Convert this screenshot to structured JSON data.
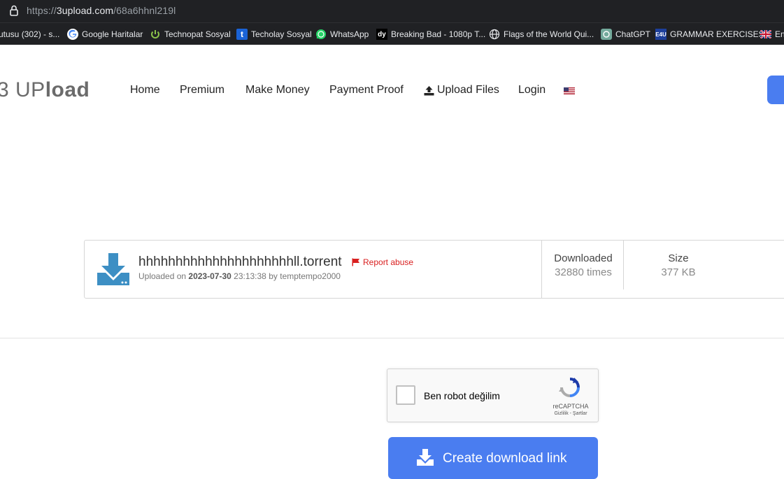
{
  "browser": {
    "url_prefix": "https://",
    "url_host": "3upload.com",
    "url_path": "/68a6hhnl219l",
    "bookmarks": [
      {
        "label": "utusu (302) - s...",
        "icon": "partial-icon"
      },
      {
        "label": "Google Haritalar",
        "icon": "google-icon"
      },
      {
        "label": "Technopat Sosyal",
        "icon": "power-icon"
      },
      {
        "label": "Techolay Sosyal",
        "icon": "techolay-icon"
      },
      {
        "label": "WhatsApp",
        "icon": "whatsapp-icon"
      },
      {
        "label": "Breaking Bad - 1080p T...",
        "icon": "dy-icon"
      },
      {
        "label": "Flags of the World Qui...",
        "icon": "globe-icon"
      },
      {
        "label": "ChatGPT",
        "icon": "chatgpt-icon"
      },
      {
        "label": "GRAMMAR EXERCISES",
        "icon": "esl-icon"
      },
      {
        "label": "En",
        "icon": "uk-flag-icon"
      }
    ]
  },
  "site": {
    "logo_a": "3 UP",
    "logo_b": "load",
    "nav": {
      "home": "Home",
      "premium": "Premium",
      "make_money": "Make Money",
      "payment_proof": "Payment Proof",
      "upload_files": "Upload Files",
      "login": "Login"
    },
    "accent": "#4a7df0"
  },
  "file": {
    "name": "hhhhhhhhhhhhhhhhhhhhhll.torrent",
    "report": "Report abuse",
    "uploaded_on_label": "Uploaded on",
    "date": "2023-07-30",
    "time": "23:13:38",
    "by_label": "by",
    "uploader": "temptempo2000",
    "downloaded_label": "Downloaded",
    "downloaded_value": "32880 times",
    "size_label": "Size",
    "size_value": "377 KB"
  },
  "captcha": {
    "label": "Ben robot değilim",
    "brand": "reCAPTCHA",
    "links": "Gizlilik - Şartlar"
  },
  "actions": {
    "create_link": "Create download link"
  }
}
